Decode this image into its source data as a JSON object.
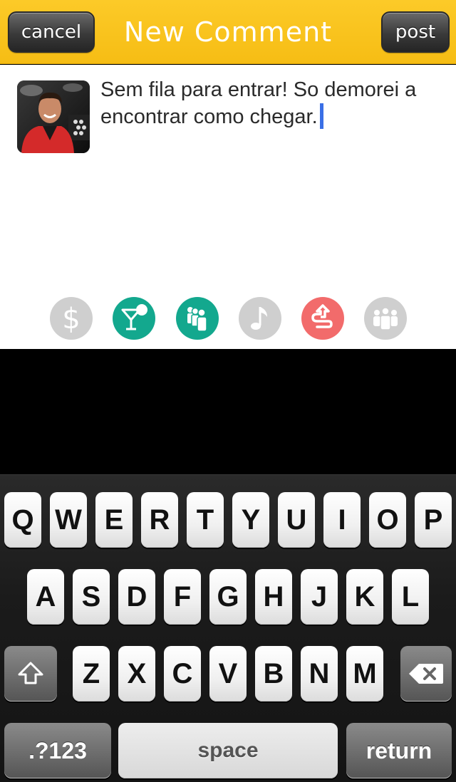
{
  "header": {
    "title": "New Comment",
    "cancel_label": "cancel",
    "post_label": "post",
    "color": "#f9c41f"
  },
  "compose": {
    "text": "Sem fila para entrar! So demorei a encontrar como chegar.",
    "caret_color": "#3a6fe6"
  },
  "categories": [
    {
      "name": "price-icon",
      "state": "inactive",
      "color": "#cfcfcf"
    },
    {
      "name": "cocktail-icon",
      "state": "active",
      "color": "#13a88e"
    },
    {
      "name": "crowd-icon",
      "state": "active",
      "color": "#13a88e"
    },
    {
      "name": "music-note-icon",
      "state": "inactive",
      "color": "#cfcfcf"
    },
    {
      "name": "queue-line-icon",
      "state": "active",
      "color": "#f26b6b"
    },
    {
      "name": "group-icon",
      "state": "inactive",
      "color": "#cfcfcf"
    }
  ],
  "keyboard": {
    "row1": [
      "Q",
      "W",
      "E",
      "R",
      "T",
      "Y",
      "U",
      "I",
      "O",
      "P"
    ],
    "row2": [
      "A",
      "S",
      "D",
      "F",
      "G",
      "H",
      "J",
      "K",
      "L"
    ],
    "row3": [
      "Z",
      "X",
      "C",
      "V",
      "B",
      "N",
      "M"
    ],
    "numbers_label": ".?123",
    "space_label": "space",
    "return_label": "return",
    "shift_icon": "shift-arrow-icon",
    "backspace_icon": "backspace-icon"
  }
}
